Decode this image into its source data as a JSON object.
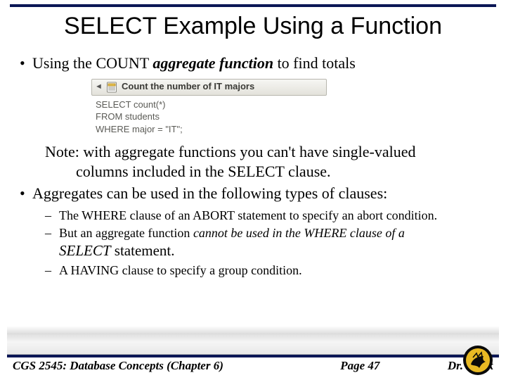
{
  "title": "SELECT Example Using a Function",
  "bullets": {
    "first_pre": "Using the COUNT ",
    "first_em": "aggregate function",
    "first_post": " to find totals",
    "second": "Aggregates can be used in the following types of clauses:"
  },
  "code": {
    "bar_label": "Count the number of IT majors",
    "arrow_glyph": "◄",
    "lines": [
      "SELECT count(*)",
      "FROM students",
      "WHERE major = \"IT\";"
    ]
  },
  "note": {
    "line1": "Note: with aggregate functions you can't have single-valued",
    "line2": "columns included in the SELECT clause."
  },
  "subs": {
    "a": "The WHERE clause of an ABORT statement to specify an abort condition.",
    "b_pre": "But an aggregate function ",
    "b_em": "cannot be used in the WHERE clause of a",
    "b_line2_em": "SELECT",
    "b_line2_post": " statement.",
    "c": "A HAVING clause to specify a group condition."
  },
  "footer": {
    "left": "CGS 2545: Database Concepts  (Chapter 6)",
    "center": "Page 47",
    "right": "Dr. Mark"
  },
  "icons": {
    "doc_icon": "table-document-icon",
    "seal": "ucf-pegasus-seal"
  }
}
